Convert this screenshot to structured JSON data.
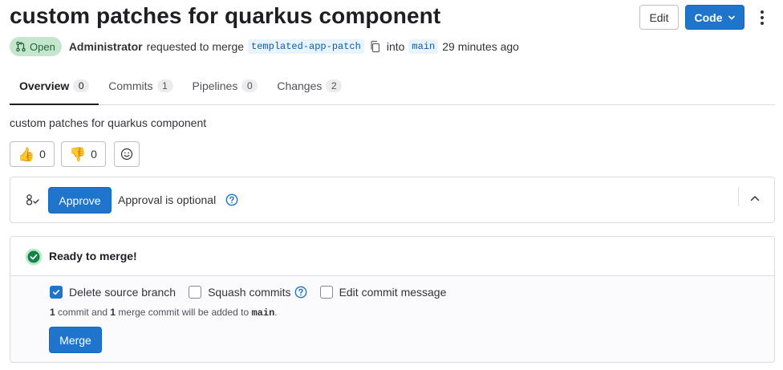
{
  "header": {
    "title": "custom patches for quarkus component",
    "edit_label": "Edit",
    "code_label": "Code"
  },
  "meta": {
    "status": "Open",
    "author": "Administrator",
    "action_text": "requested to merge",
    "source_branch": "templated-app-patch",
    "into_text": "into",
    "target_branch": "main",
    "time_ago": "29 minutes ago"
  },
  "tabs": [
    {
      "label": "Overview",
      "count": "0",
      "active": true
    },
    {
      "label": "Commits",
      "count": "1",
      "active": false
    },
    {
      "label": "Pipelines",
      "count": "0",
      "active": false
    },
    {
      "label": "Changes",
      "count": "2",
      "active": false
    }
  ],
  "description": "custom patches for quarkus component",
  "awards": {
    "thumbs_up_emoji": "👍",
    "thumbs_up_count": "0",
    "thumbs_down_emoji": "👎",
    "thumbs_down_count": "0"
  },
  "approval": {
    "approvals_icon": "approval-icon",
    "approve_label": "Approve",
    "status_text": "Approval is optional"
  },
  "merge": {
    "ready_text": "Ready to merge!",
    "options": [
      {
        "label": "Delete source branch",
        "checked": true,
        "help": false
      },
      {
        "label": "Squash commits",
        "checked": false,
        "help": true
      },
      {
        "label": "Edit commit message",
        "checked": false,
        "help": false
      }
    ],
    "info_count1": "1",
    "info_text1": " commit and ",
    "info_count2": "1",
    "info_text2": " merge commit will be added to ",
    "info_branch": "main",
    "info_end": ".",
    "merge_label": "Merge"
  },
  "colors": {
    "primary": "#1f75cb",
    "success": "#108548",
    "open_badge_bg": "#c3e6cd",
    "branch_bg": "#e9f3fc"
  }
}
